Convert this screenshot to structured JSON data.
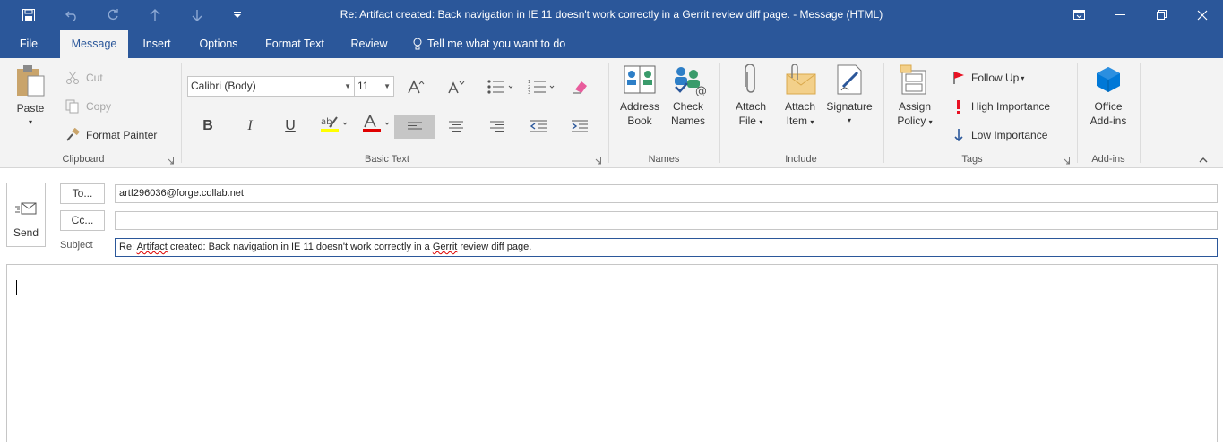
{
  "window": {
    "title": "Re: Artifact created: Back navigation in IE 11 doesn't work correctly in a Gerrit review diff page.  -  Message (HTML)"
  },
  "tabs": [
    {
      "label": "File"
    },
    {
      "label": "Message",
      "active": true
    },
    {
      "label": "Insert"
    },
    {
      "label": "Options"
    },
    {
      "label": "Format Text"
    },
    {
      "label": "Review"
    },
    {
      "label": "Tell me what you want to do",
      "icon": "lightbulb-icon"
    }
  ],
  "ribbon": {
    "clipboard": {
      "paste": "Paste",
      "cut": "Cut",
      "copy": "Copy",
      "format_painter": "Format Painter",
      "label": "Clipboard"
    },
    "basic_text": {
      "font_name": "Calibri (Body)",
      "font_size": "11",
      "label": "Basic Text"
    },
    "names": {
      "address_book_1": "Address",
      "address_book_2": "Book",
      "check_names_1": "Check",
      "check_names_2": "Names",
      "label": "Names"
    },
    "include": {
      "attach_file_1": "Attach",
      "attach_file_2": "File",
      "attach_item_1": "Attach",
      "attach_item_2": "Item",
      "signature": "Signature",
      "label": "Include"
    },
    "tags": {
      "assign_policy_1": "Assign",
      "assign_policy_2": "Policy",
      "follow_up": "Follow Up",
      "high_importance": "High Importance",
      "low_importance": "Low Importance",
      "label": "Tags"
    },
    "addins": {
      "office_addins_1": "Office",
      "office_addins_2": "Add-ins",
      "label": "Add-ins"
    }
  },
  "compose": {
    "send": "Send",
    "to_button": "To...",
    "cc_button": "Cc...",
    "to_value": "artf296036@forge.collab.net",
    "cc_value": "",
    "subject_label": "Subject",
    "subject_pre": "Re: ",
    "subject_w1": "Artifact",
    "subject_mid": " created: Back navigation in IE 11 doesn't work correctly in a ",
    "subject_w2": "Gerrit",
    "subject_post": " review diff page."
  },
  "colors": {
    "accent": "#2b579a",
    "ribbon_bg": "#f3f3f3",
    "highlight_yellow": "#ffff00",
    "font_red": "#e00000",
    "importance_red": "#e81123",
    "office_blue": "#0078d7"
  }
}
